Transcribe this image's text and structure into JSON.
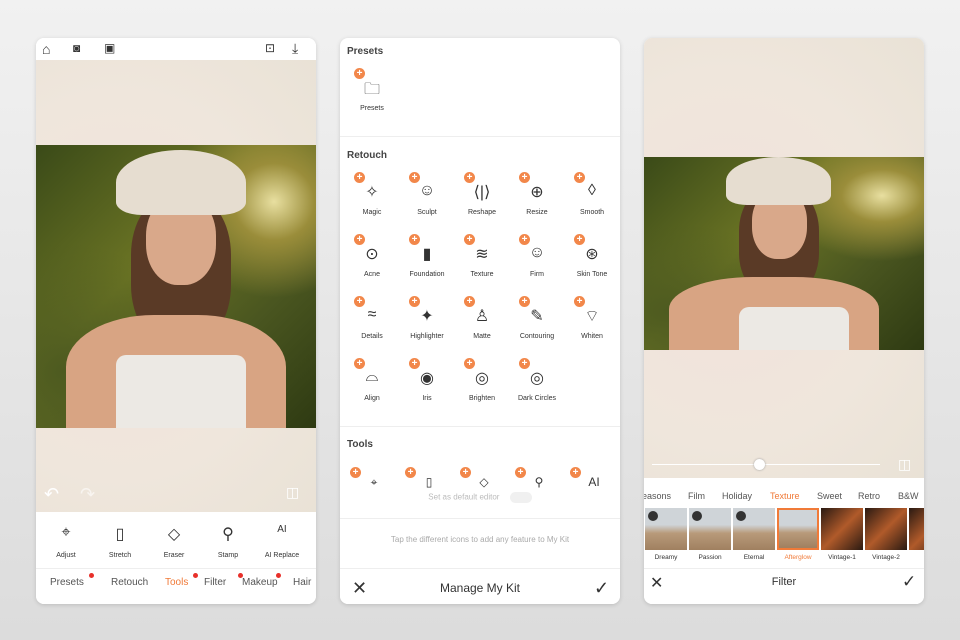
{
  "left": {
    "top_icons": [
      "home-icon",
      "camera-icon",
      "gallery-icon"
    ],
    "top_right_icons": [
      "compare-icon",
      "download-icon"
    ],
    "tools": [
      {
        "label": "Adjust",
        "icon": "⌖"
      },
      {
        "label": "Stretch",
        "icon": "▯"
      },
      {
        "label": "Eraser",
        "icon": "◇"
      },
      {
        "label": "Stamp",
        "icon": "⚲"
      },
      {
        "label": "AI Replace",
        "icon": "AI"
      }
    ],
    "tabs": [
      {
        "label": "Presets",
        "dot": true
      },
      {
        "label": "Retouch",
        "dot": false
      },
      {
        "label": "Tools",
        "dot": true,
        "active": true
      },
      {
        "label": "Filter",
        "dot": true
      },
      {
        "label": "Makeup",
        "dot": true
      },
      {
        "label": "Hair",
        "dot": false
      }
    ]
  },
  "middle": {
    "presets_title": "Presets",
    "presets": [
      {
        "label": "Presets",
        "icon": "🗀"
      }
    ],
    "retouch_title": "Retouch",
    "retouch": [
      {
        "label": "Magic",
        "icon": "✧"
      },
      {
        "label": "Sculpt",
        "icon": "☺"
      },
      {
        "label": "Reshape",
        "icon": "⟨|⟩"
      },
      {
        "label": "Resize",
        "icon": "⊕"
      },
      {
        "label": "Smooth",
        "icon": "◊"
      },
      {
        "label": "Acne",
        "icon": "⊙"
      },
      {
        "label": "Foundation",
        "icon": "▮"
      },
      {
        "label": "Texture",
        "icon": "≋"
      },
      {
        "label": "Firm",
        "icon": "☺"
      },
      {
        "label": "Skin Tone",
        "icon": "⊛"
      },
      {
        "label": "Details",
        "icon": "≈"
      },
      {
        "label": "Highlighter",
        "icon": "✦"
      },
      {
        "label": "Matte",
        "icon": "♙"
      },
      {
        "label": "Contouring",
        "icon": "✎"
      },
      {
        "label": "Whiten",
        "icon": "⌔"
      },
      {
        "label": "Align",
        "icon": "⌓"
      },
      {
        "label": "Iris",
        "icon": "◉"
      },
      {
        "label": "Brighten",
        "icon": "◎"
      },
      {
        "label": "Dark Circles",
        "icon": "◎"
      }
    ],
    "tools_title": "Tools",
    "tools_icons": [
      "⌖",
      "▯",
      "◇",
      "⚲",
      "AI"
    ],
    "default_editor": "Set as default editor",
    "hint": "Tap the different icons to add any feature to My Kit",
    "title": "Manage My Kit"
  },
  "right": {
    "categories": [
      "easons",
      "Film",
      "Holiday",
      "Texture",
      "Sweet",
      "Retro",
      "B&W"
    ],
    "active_category": "Texture",
    "filters": [
      {
        "label": "Dreamy",
        "v": false
      },
      {
        "label": "Passion",
        "v": false
      },
      {
        "label": "Eternal",
        "v": false
      },
      {
        "label": "Afterglow",
        "v": false,
        "active": true
      },
      {
        "label": "Vintage-1",
        "v": true
      },
      {
        "label": "Vintage-2",
        "v": true
      },
      {
        "label": "Vin",
        "v": true
      }
    ],
    "slider_value": 0.47,
    "title": "Filter"
  },
  "colors": {
    "accent": "#f07a38",
    "plus": "#f2874a"
  }
}
